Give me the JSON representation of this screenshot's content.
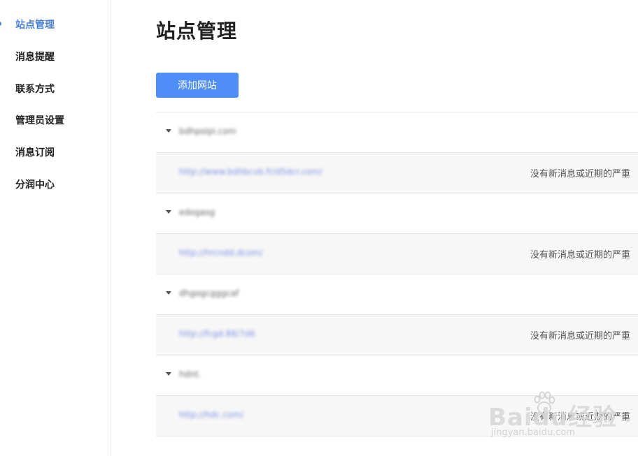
{
  "sidebar": {
    "items": [
      {
        "label": "站点管理",
        "active": true
      },
      {
        "label": "消息提醒",
        "active": false
      },
      {
        "label": "联系方式",
        "active": false
      },
      {
        "label": "管理员设置",
        "active": false
      },
      {
        "label": "消息订阅",
        "active": false
      },
      {
        "label": "分润中心",
        "active": false
      }
    ]
  },
  "main": {
    "title": "站点管理",
    "add_button_label": "添加网站",
    "sites": [
      {
        "domain": "bdhpoipi.com",
        "url": "http://www.bdhbcvb.fr/d5dcr.com/",
        "status": "没有新消息或近期的严重"
      },
      {
        "domain": "edogasg",
        "url": "http://hrcndd.dcom/",
        "status": "没有新消息或近期的严重"
      },
      {
        "domain": "dhgogcgggcaf",
        "url": "http://fcgd.88/7d6",
        "status": "没有新消息或近期的严重"
      },
      {
        "domain": "hdnt.",
        "url": "http://hdc.com/",
        "status": "没有新消息或近期的严重"
      }
    ]
  },
  "watermark": {
    "main": "Baidu经验",
    "sub": "jingyan.baidu.com"
  },
  "colors": {
    "accent": "#4f8ef7",
    "active_nav": "#4a7fd6",
    "link": "#7f8fe6"
  }
}
